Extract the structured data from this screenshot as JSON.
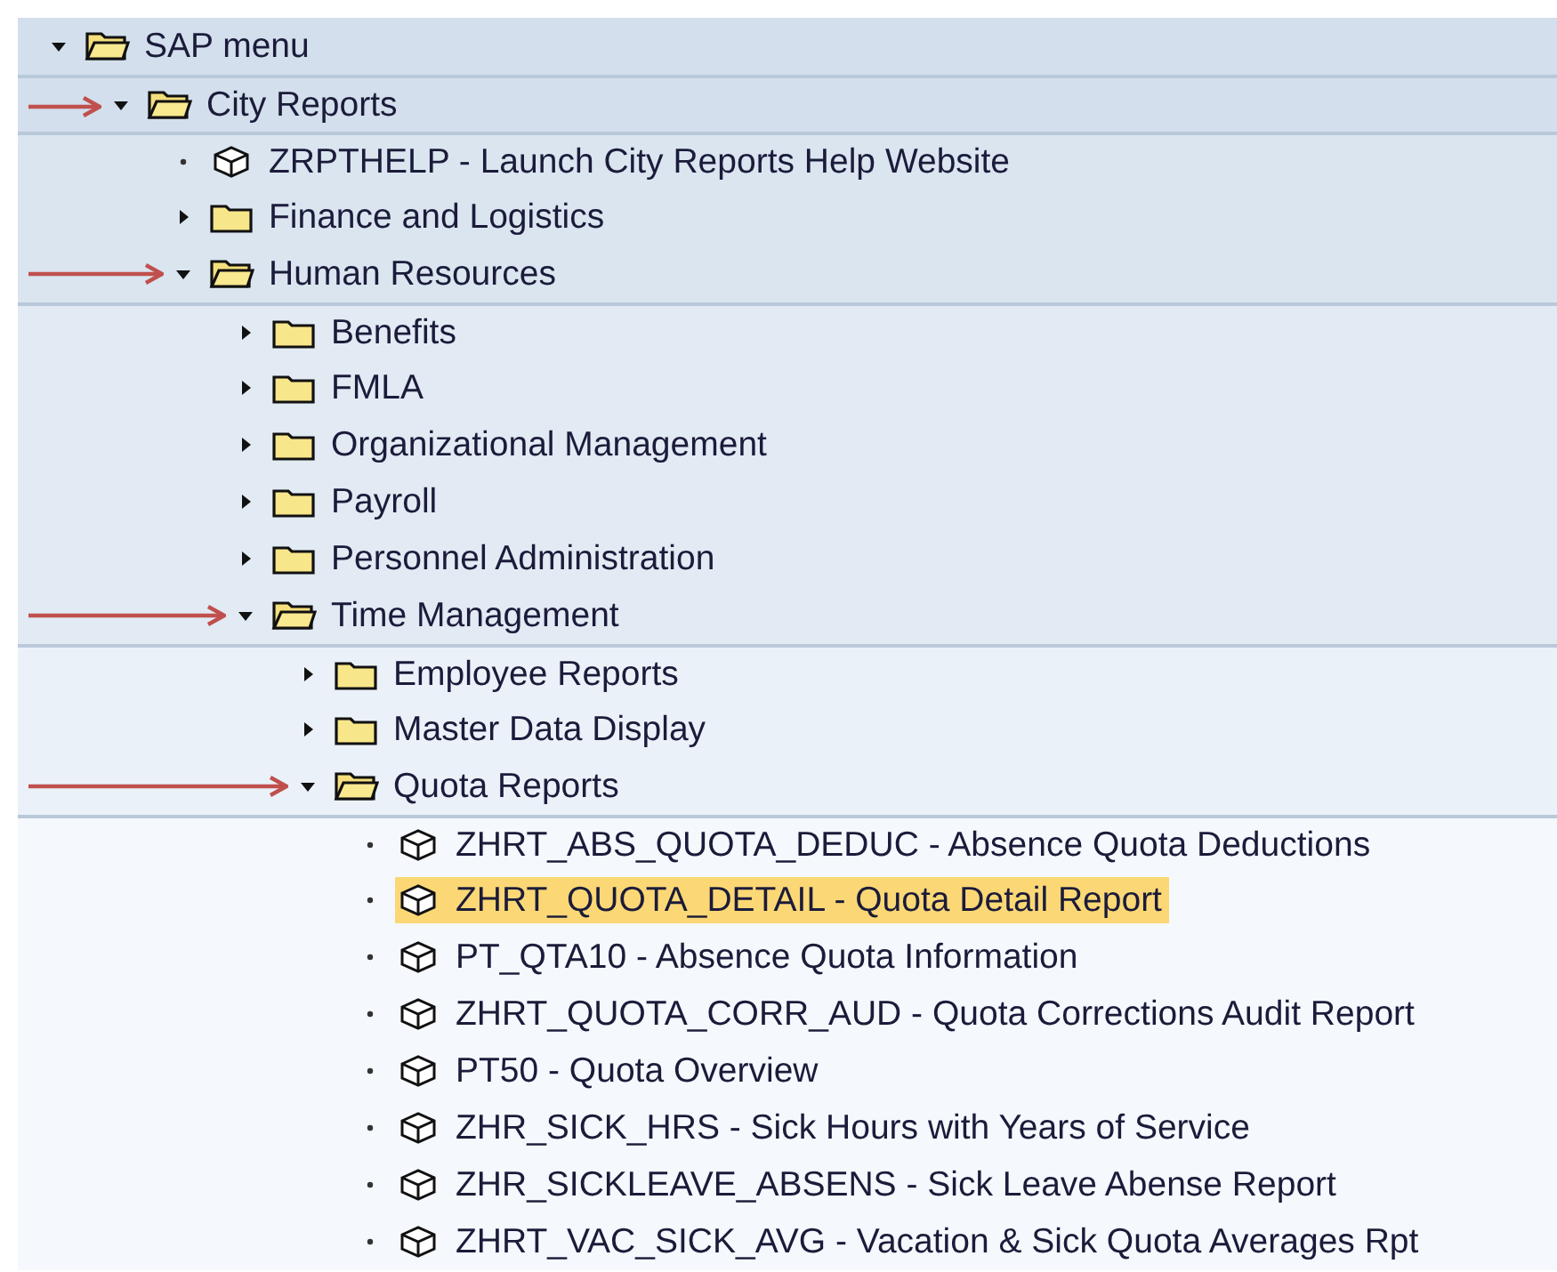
{
  "tree": [
    {
      "kind": "folder",
      "label": "SAP menu",
      "expanded": true,
      "selected": false,
      "arrow": false,
      "children": [
        {
          "kind": "folder",
          "label": "City Reports",
          "expanded": true,
          "selected": false,
          "arrow": true,
          "children": [
            {
              "kind": "transaction",
              "label": "ZRPTHELP - Launch City Reports Help Website",
              "selected": false,
              "arrow": false
            },
            {
              "kind": "folder",
              "label": "Finance and Logistics",
              "expanded": false,
              "selected": false,
              "arrow": false
            },
            {
              "kind": "folder",
              "label": "Human Resources",
              "expanded": true,
              "selected": false,
              "arrow": true,
              "children": [
                {
                  "kind": "folder",
                  "label": "Benefits",
                  "expanded": false,
                  "selected": false,
                  "arrow": false
                },
                {
                  "kind": "folder",
                  "label": "FMLA",
                  "expanded": false,
                  "selected": false,
                  "arrow": false
                },
                {
                  "kind": "folder",
                  "label": "Organizational Management",
                  "expanded": false,
                  "selected": false,
                  "arrow": false
                },
                {
                  "kind": "folder",
                  "label": "Payroll",
                  "expanded": false,
                  "selected": false,
                  "arrow": false
                },
                {
                  "kind": "folder",
                  "label": "Personnel Administration",
                  "expanded": false,
                  "selected": false,
                  "arrow": false
                },
                {
                  "kind": "folder",
                  "label": "Time Management",
                  "expanded": true,
                  "selected": false,
                  "arrow": true,
                  "children": [
                    {
                      "kind": "folder",
                      "label": "Employee Reports",
                      "expanded": false,
                      "selected": false,
                      "arrow": false
                    },
                    {
                      "kind": "folder",
                      "label": "Master Data Display",
                      "expanded": false,
                      "selected": false,
                      "arrow": false
                    },
                    {
                      "kind": "folder",
                      "label": "Quota Reports",
                      "expanded": true,
                      "selected": false,
                      "arrow": true,
                      "children": [
                        {
                          "kind": "transaction",
                          "label": "ZHRT_ABS_QUOTA_DEDUC - Absence Quota Deductions",
                          "selected": false,
                          "arrow": false
                        },
                        {
                          "kind": "transaction",
                          "label": "ZHRT_QUOTA_DETAIL - Quota Detail Report",
                          "selected": true,
                          "arrow": false
                        },
                        {
                          "kind": "transaction",
                          "label": "PT_QTA10 - Absence Quota Information",
                          "selected": false,
                          "arrow": false
                        },
                        {
                          "kind": "transaction",
                          "label": "ZHRT_QUOTA_CORR_AUD - Quota Corrections Audit Report",
                          "selected": false,
                          "arrow": false
                        },
                        {
                          "kind": "transaction",
                          "label": "PT50 - Quota Overview",
                          "selected": false,
                          "arrow": false
                        },
                        {
                          "kind": "transaction",
                          "label": "ZHR_SICK_HRS - Sick Hours with Years of Service",
                          "selected": false,
                          "arrow": false
                        },
                        {
                          "kind": "transaction",
                          "label": "ZHR_SICKLEAVE_ABSENS - Sick Leave Abense Report",
                          "selected": false,
                          "arrow": false
                        },
                        {
                          "kind": "transaction",
                          "label": "ZHRT_VAC_SICK_AVG - Vacation & Sick Quota Averages Rpt",
                          "selected": false,
                          "arrow": false
                        }
                      ]
                    }
                  ]
                }
              ]
            }
          ]
        }
      ]
    }
  ]
}
